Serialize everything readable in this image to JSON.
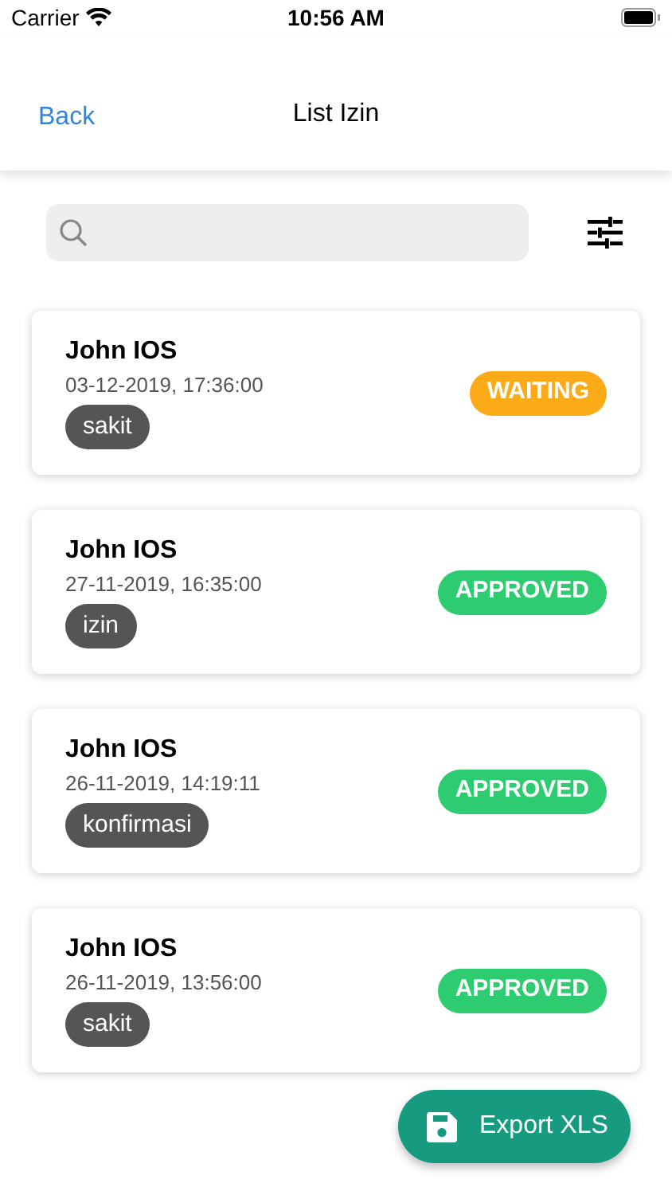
{
  "status_bar": {
    "carrier": "Carrier",
    "time": "10:56 AM"
  },
  "nav": {
    "back": "Back",
    "title": "List Izin"
  },
  "items": [
    {
      "name": "John IOS",
      "datetime": "03-12-2019, 17:36:00",
      "tag": "sakit",
      "status": "WAITING",
      "color": "#fbab18"
    },
    {
      "name": "John IOS",
      "datetime": "27-11-2019, 16:35:00",
      "tag": "izin",
      "status": "APPROVED",
      "color": "#2ecc71"
    },
    {
      "name": "John IOS",
      "datetime": "26-11-2019, 14:19:11",
      "tag": "konfirmasi",
      "status": "APPROVED",
      "color": "#2ecc71"
    },
    {
      "name": "John IOS",
      "datetime": "26-11-2019, 13:56:00",
      "tag": "sakit",
      "status": "APPROVED",
      "color": "#2ecc71"
    }
  ],
  "export_button": "Export XLS"
}
